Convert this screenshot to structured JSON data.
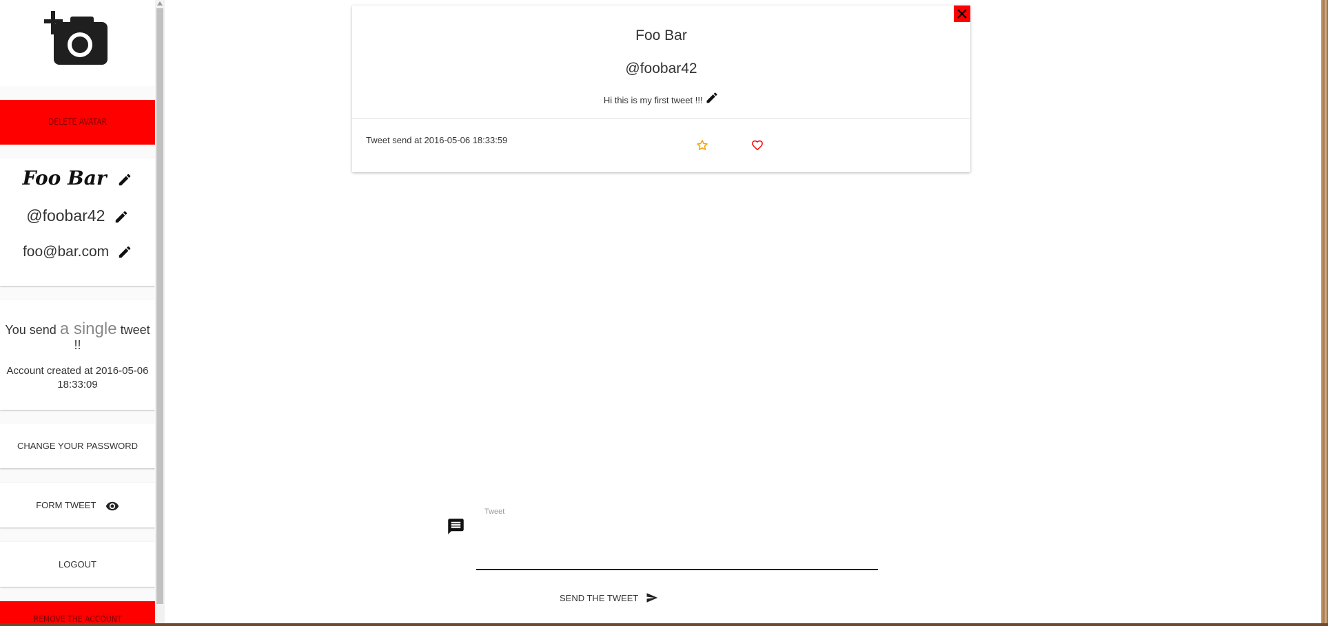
{
  "sidebar": {
    "avatar_icon": "add-a-photo-icon",
    "delete_avatar_label": "Delete avatar",
    "profile": {
      "name": "Foo Bar",
      "handle": "@foobar42",
      "email": "foo@bar.com"
    },
    "stats": {
      "prefix": "You send",
      "count_text": "a single",
      "suffix": "tweet",
      "exclaim": "!!",
      "created": "Account created at 2016-05-06 18:33:09"
    },
    "change_password_label": "Change your password",
    "form_tweet_label": "Form tweet",
    "logout_label": "Logout",
    "remove_account_label": "Remove the account"
  },
  "tweet": {
    "name": "Foo Bar",
    "handle": "@foobar42",
    "text": "Hi this is my first tweet !!!",
    "date": "Tweet send at 2016-05-06 18:33:59"
  },
  "compose": {
    "label": "Tweet",
    "value": "",
    "send_label": "Send the tweet"
  },
  "colors": {
    "danger": "#ff0000",
    "star": "#f4a300",
    "heart": "#ff0000"
  }
}
